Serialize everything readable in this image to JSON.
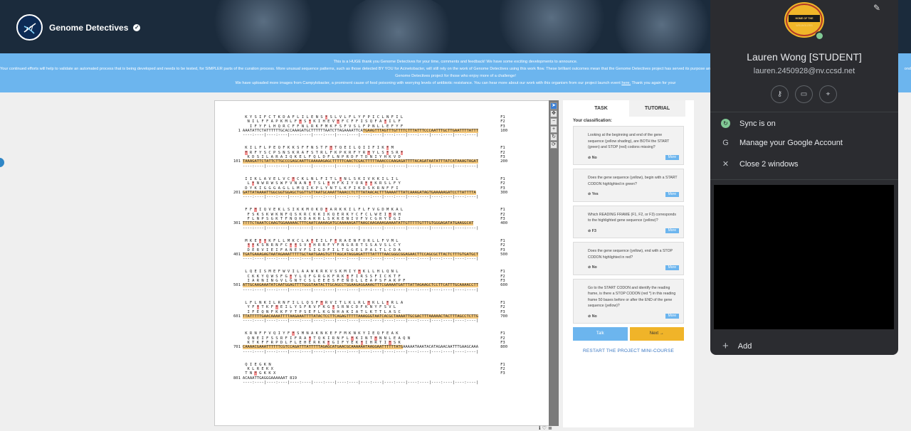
{
  "header": {
    "brand": "Genome Detectives"
  },
  "banner": {
    "line1": "This is a HUGE thank you Genome Detectives for your time, comments and feedback! We have some exciting developments to announce.",
    "line2": "Your continued efforts will help to validate an automated process that is being developed and needs to be tested, for SIMPLER parts of the curation process. More unusual sequence patterns, such as those detected BY YOU for Acinetobacter, will still rely on the work of Genome Detectives using this work flow. These brilliant outcomes mean that the Genome Detectives project has served its purpose and",
    "line3": "Genome Detectives project for those who enjoy more of a challenge!",
    "line4a": "We have uploaded more images from Campylobacter, a prominent cause of food poisoning with worrying levels of antibiotic resistance. You can hear more about our work with this organism from our project launch event",
    "link": "here.",
    "line4b": "Thank you again for your",
    "line2_tail": "ond"
  },
  "sequence": {
    "blocks": [
      {
        "f1": " K Y S I F C T K D A F L I L E N S * S L V L F L Y F P I C L N F I L",
        "f2": "  N I L F F A P K M L F * S * K I H E V * F C F F I S Q F A * I L F",
        "f3": "   I F Y F L H Q R C F F N L R K F M K F S F V S L F P N L L E F Y F",
        "num": "1",
        "dna": "AAATATTCTATTTTTTGCACCAAAGATGCTTTTTTAATCTTAGAAAATTCATGAAGTTTAGTTTGTTTTCTTTATTTCCCAATTTGCTTGAATTTTATTT",
        "end": "100",
        "hlFrom": 51
      },
      {
        "f1": " K I L F L P E Q F K K S F F N S T F * T Q E I L Q I I F I K * M",
        "f2": " * R F Y S C P S N S K R A F S T R L F K P K R F Y R * Y L S * S R *",
        "f3": "  K D S I L A R A I Q K E L F Q L D F L N P R D F T D N I Y H K V D",
        "num": "101",
        "dna": "TAAAGATTCTATTCTTGCCCGAGCAATTCAAAAAGAGCTTTTTCAACTCGACTTTTTAAACCCAAGAGATTTTACAGATAATATTTATCATAAAGTAGAT",
        "end": "200",
        "hlFrom": 0
      },
      {
        "f1": " I I K L A V E L V C * C K L N L F I T L * N L S K I V K K I L I L",
        "f2": "  L * N W R W S W F V N A N * T S L * H F K I Y O R * * K R S L F Y",
        "f3": " D Y K I G G G A G L L M Q I K P L Y N T L K F I K D S K R N F F I",
        "num": "201",
        "dna": "GATTATAAAATTGGCGGTGGAGCTGGTTGTTAATGCAAATTAAACCTCTTTATAACACTTTAAAATTTATCAAAGATAGTGAAAAAGATCCTTATTTTA",
        "end": "300",
        "hlFrom": 0
      },
      {
        "f1": " F F * I Q V E K L S I K K M O K D * A R K K I L F L F V G D M K A L",
        "f2": "  F S K S K W K N F Q S K R C K K I K Q E R K Y C F C L W E I * R H",
        "f3": "  F L N P S G K T F N Q K D A K R L S K K E N I V F V C G R Y E G I",
        "num": "301",
        "dna": "TTTTCTAAATCCAAGTGGAAAAACTTTCAATCAAAAGATGCAAAAAGATTAAGCAAGAAAGAAAATATTGTTTTTGTTTGTGGGAGATATGAAGGCAT",
        "end": "400",
        "hlFrom": 0
      },
      {
        "f1": " M K E * * K F L L M K C L A * E I L F * R A E N F O R L L F V M L",
        "f2": "  * * K S N R N F C * * S V * H R R F Y F N G R R T S S A V S L C Y",
        "f3": "  D E R V I E I F A N E V F S I G D F I L T G G E L P A L T L C D A",
        "num": "401",
        "dna": "TGATGAAAGAGTAATAGAAATTTTTGCTAATGAAGTGTTTAGCATAGGAGATTTTATTTTAACGGGCGGAGAACTTCCAGCGCTTACTCTTTGTGATGCT",
        "end": "500",
        "hlFrom": 0
      },
      {
        "f1": " L Q E I S M E F W V I L A A W K R K V S K M I Y * K L L H L Q N L",
        "f2": "  C K K Y Q W S F G * Y L Q F G R G K F R K * F I R S S F I C K T F",
        "f3": "  I A R N I N G V L G N T C S L E E E S F E N D L L E A P S F A K P F",
        "num": "501",
        "dna": "ATTGCAAGAAATATCAATGGAGTTTTGGGTAATACTTGCAGCCTGGAAGAGGAAAGTTTCGAAAATGATTTATTAGAAGCTCCTTCATTTGCAAAACCTT",
        "end": "600",
        "hlFrom": 0
      },
      {
        "f1": " L F L N K I L R N F I L L Q S F * R V I T L K L R L * K L L * R L A",
        "f2": "  Y F * T K F * E I L Y S F R V F K G * S R N C D F K N Y F S V L",
        "f3": "  I F E Q N F K K F Y T P S E F L K G N H A K I A T L K T T L A S C",
        "num": "601",
        "dna": "TTATTTTTGAACAAAATTTTAAGAAATTTTATACTCCTTCAGAGTTTTTAAAGGGTAATCACGCTAAAATTGCGACTTTAAAAACTACTTTAGCCTCTTG",
        "end": "700",
        "hlFrom": 0
      },
      {
        "f1": " K R N F F V Q I Y F * S M N A K N K E F F M K N K Y I E Q F E A K",
        "f2": "  Q N E I F S S R F I F R A * T Q K I R N F L * K I N T * N N L E A Q N",
        "f3": "  K T K F F R P D L F L E H E R K K * G I F Y E K * I H R T I * S K",
        "num": "701",
        "dna": "CAAAACGAAATTTTTTCGTCCAGATTTATTTTTAGAGCATGAACGCAAAAAATAAGGAATTTTTTATGAAAAATAAATACATAGAACAATTTGAAGCAAA",
        "end": "800",
        "hlFrom": 0,
        "hlTo": 68
      },
      {
        "f1": " Q I E G K N",
        "f2": "  K L R E K X",
        "f3": " T N * G K K X",
        "num": "801",
        "dna": "ACAAATTGAGGGAAAAAAT 819",
        "end": "",
        "hlFrom": -1
      }
    ]
  },
  "task_panel": {
    "tab_task": "TASK",
    "tab_tutorial": "TUTORIAL",
    "classification_label": "Your classification:",
    "questions": [
      {
        "text": "Looking at the beginning and end of the gene sequence (yellow shading), are BOTH the START (green) and STOP (red) codons missing?",
        "answer": "No",
        "more": "More"
      },
      {
        "text": "Does the gene sequence (yellow), begin with a START CODON highlighted in green?",
        "answer": "Yes",
        "more": "More"
      },
      {
        "text": "Which READING FRAME (F1, F2, or F3) corresponds to the highlighted gene sequence (yellow)?",
        "answer": "F3",
        "more": "More"
      },
      {
        "text": "Does the gene sequence (yellow), end with a STOP CODON highlighted in red?",
        "answer": "No",
        "more": "More"
      },
      {
        "text": "Go to the START CODON and identify the reading frame, is there a STOP CODON (red *) in this reading frame 50 bases before or after the END of the gene sequence (yellow)?",
        "answer": "No",
        "more": "More"
      }
    ],
    "talk": "Talk",
    "next": "Next →",
    "restart": "RESTART THE PROJECT MINI-COURSE"
  },
  "profile": {
    "avatar_text": "HOME OF THE WRANGLERS",
    "name": "Lauren Wong [STUDENT]",
    "email": "lauren.2450928@nv.ccsd.net",
    "sync": "Sync is on",
    "manage": "Manage your Google Account",
    "close": "Close 2 windows",
    "add": "Add"
  },
  "icons": [
    "pencil-icon",
    "key-icon",
    "card-icon",
    "location-icon",
    "sync-icon",
    "google-icon",
    "close-icon",
    "plus-icon"
  ]
}
